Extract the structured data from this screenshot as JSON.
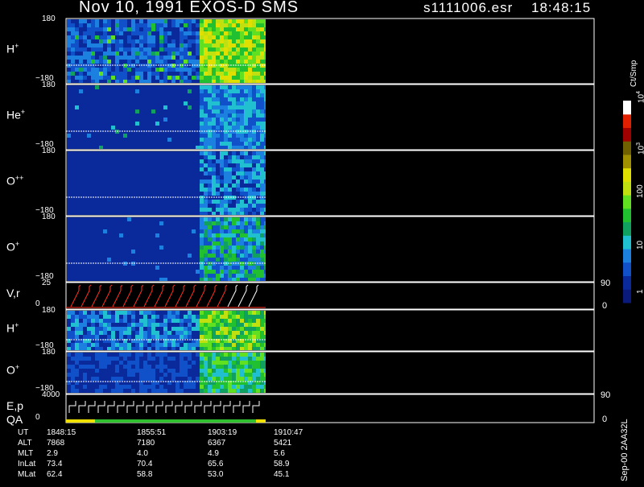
{
  "header": {
    "title": "Nov 10, 1991    EXOS-D SMS",
    "file": "s1111006.esr",
    "time": "18:48:15"
  },
  "chart_data": {
    "type": "heatmap",
    "panels": [
      {
        "id": "h_plus_1",
        "label": "H",
        "sup": "+",
        "ytick_top": "180",
        "ytick_bottom": "−180",
        "ylim": [
          -180,
          180
        ]
      },
      {
        "id": "he_plus",
        "label": "He",
        "sup": "+",
        "ytick_top": "180",
        "ytick_bottom": "−180",
        "ylim": [
          -180,
          180
        ]
      },
      {
        "id": "o_plusplus",
        "label": "O",
        "sup": "++",
        "ytick_top": "180",
        "ytick_bottom": "−180",
        "ylim": [
          -180,
          180
        ]
      },
      {
        "id": "o_plus_1",
        "label": "O",
        "sup": "+",
        "ytick_top": "180",
        "ytick_bottom": "−180",
        "ylim": [
          -180,
          180
        ]
      },
      {
        "id": "vr",
        "label": "V,r",
        "sup": "",
        "ytick_top": "25",
        "ytick_bottom": "0",
        "right_top": "90",
        "right_bottom": "0"
      },
      {
        "id": "h_plus_2",
        "label": "H",
        "sup": "+",
        "ytick_top": "180",
        "ytick_bottom": "−180",
        "ylim": [
          -180,
          180
        ]
      },
      {
        "id": "o_plus_2",
        "label": "O",
        "sup": "+",
        "ytick_top": "180",
        "ytick_bottom": "−180",
        "ylim": [
          -180,
          180
        ]
      },
      {
        "id": "ep_qa",
        "label": "E,p",
        "label2": "QA",
        "sup": "",
        "ytick_top": "4000",
        "ytick_bottom": "0",
        "right_top": "90",
        "right_bottom": "0"
      }
    ],
    "colorbar": {
      "label": "Ct/Smp",
      "ticks": [
        {
          "base": "10",
          "exp": "4"
        },
        {
          "base": "10",
          "exp": "3"
        },
        {
          "base": "100",
          "exp": ""
        },
        {
          "base": "10",
          "exp": ""
        },
        {
          "base": "1",
          "exp": ""
        }
      ],
      "scale": "log",
      "range": [
        1,
        10000
      ],
      "colors": [
        "#0a1a7a",
        "#0a2a9c",
        "#1050c8",
        "#1c80e0",
        "#20c0d0",
        "#10a060",
        "#20c030",
        "#60e020",
        "#c0e010",
        "#e0e000",
        "#a09000",
        "#706000",
        "#a00000",
        "#e02000",
        "#ffffff"
      ]
    },
    "footer": {
      "rows": [
        {
          "name": "UT",
          "values": [
            "1848:15",
            "1855:51",
            "1903:19",
            "1910:47"
          ]
        },
        {
          "name": "ALT",
          "values": [
            "7868",
            "7180",
            "6367",
            "5421"
          ]
        },
        {
          "name": "MLT",
          "values": [
            "2.9",
            "4.0",
            "4.9",
            "5.6"
          ]
        },
        {
          "name": "InLat",
          "values": [
            "73.4",
            "70.4",
            "65.6",
            "58.9"
          ]
        },
        {
          "name": "MLat",
          "values": [
            "62.4",
            "58.8",
            "53.0",
            "45.1"
          ]
        }
      ]
    },
    "side_note": "Sep-00  2AA32L"
  }
}
